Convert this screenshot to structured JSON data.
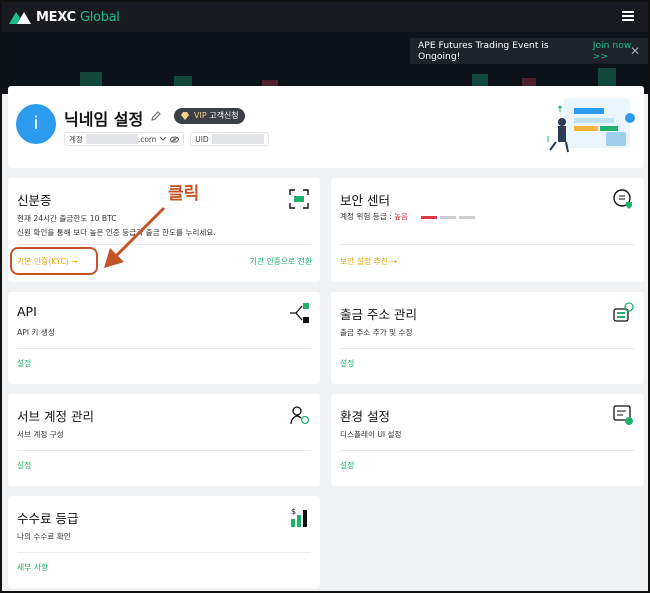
{
  "header": {
    "brand_main": "MEXC",
    "brand_sub": "Global"
  },
  "banner": {
    "text": "APE Futures Trading Event is Ongoing!",
    "join": "Join now >>",
    "close": "✕"
  },
  "profile": {
    "avatar_letter": "i",
    "nickname": "닉네임 설정",
    "vip_label": "VIP",
    "vip_sub": "고객신청",
    "account_label": "계정",
    "account_suffix": ".com",
    "uid_label": "UID"
  },
  "cards": {
    "identity": {
      "title": "신분증",
      "desc1": "현재 24시간 출금한도 10 BTC",
      "desc2": "신원 확인을 통해 보다 높은 인증 등급과 출금 한도를 누리세요.",
      "link_left": "기본 인증(KYC) →",
      "link_right": "기관 인증으로 전환"
    },
    "security": {
      "title": "보안 센터",
      "level_label": "계정 위험 등급 :",
      "level_value": "높음",
      "link": "보안 설정 추천 →"
    },
    "api": {
      "title": "API",
      "desc": "API 키 생성",
      "link": "설정"
    },
    "withdraw": {
      "title": "출금 주소 관리",
      "desc": "출금 주소 추가 및 수정",
      "link": "설정"
    },
    "subaccount": {
      "title": "서브 계정 관리",
      "desc": "서브 계정 구성",
      "link": "설정"
    },
    "preferences": {
      "title": "환경 설정",
      "desc": "디스플레이 UI 설정",
      "link": "설정"
    },
    "fees": {
      "title": "수수료 등급",
      "desc": "나의 수수료 확인",
      "link": "세부 사항"
    }
  },
  "annotation": {
    "click_text": "클릭"
  },
  "colors": {
    "accent": "#20b26c",
    "gold": "#e8a400",
    "annotation": "#c4552a",
    "danger": "#e0364c"
  }
}
